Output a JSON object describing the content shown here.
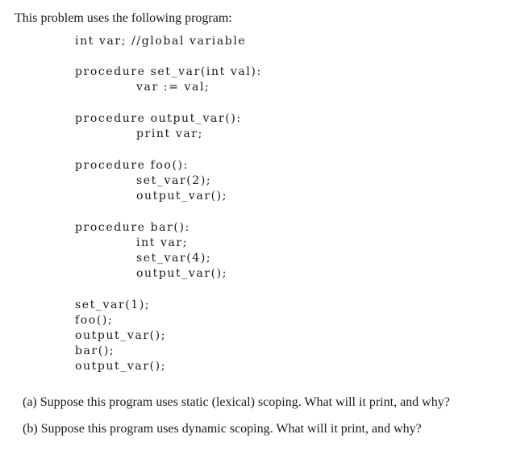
{
  "intro": "This problem uses the following program:",
  "code": {
    "global_decl": "int var; //global variable",
    "set_var": {
      "header": "procedure set_var(int val):",
      "body": [
        "var := val;"
      ]
    },
    "output_var": {
      "header": "procedure output_var():",
      "body": [
        "print var;"
      ]
    },
    "foo": {
      "header": "procedure foo():",
      "body": [
        "set_var(2);",
        "output_var();"
      ]
    },
    "bar": {
      "header": "procedure bar():",
      "body": [
        "int var;",
        "set_var(4);",
        "output_var();"
      ]
    },
    "main": [
      "set_var(1);",
      "foo();",
      "output_var();",
      "bar();",
      "output_var();"
    ]
  },
  "questions": [
    {
      "label": "(a)",
      "text": "Suppose this program uses static (lexical) scoping. What will it print, and why?"
    },
    {
      "label": "(b)",
      "text": "Suppose this program uses dynamic scoping. What will it print, and why?"
    }
  ]
}
